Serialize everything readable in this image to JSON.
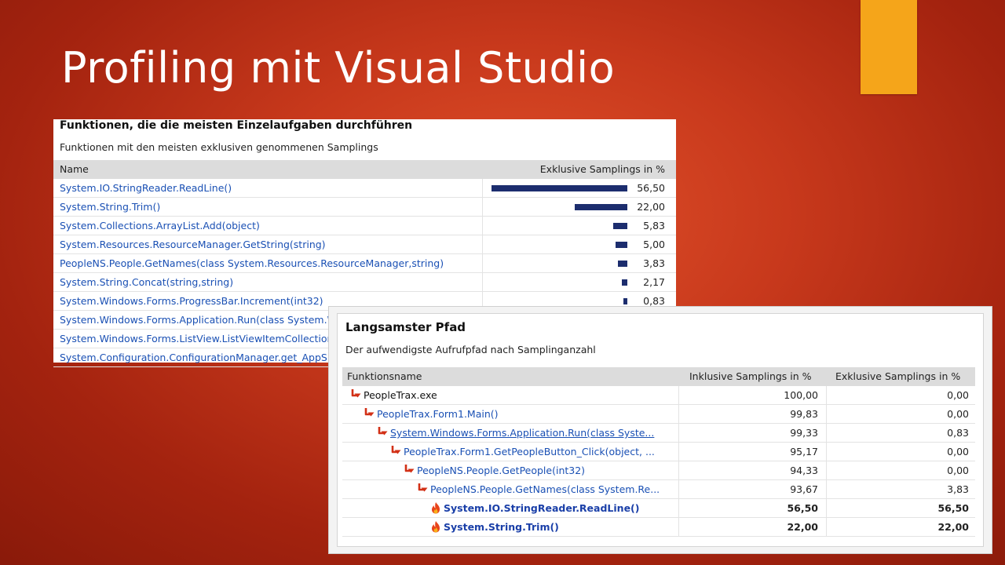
{
  "slide": {
    "title": "Profiling mit Visual Studio",
    "accent_color": "#f5a51a",
    "background_color": "#c8391c"
  },
  "panel1": {
    "title": "Funktionen, die die meisten Einzelaufgaben durchführen",
    "subtitle": "Funktionen mit den meisten exklusiven genommenen Samplings",
    "columns": {
      "name": "Name",
      "exclusive": "Exklusive Samplings in %"
    },
    "rows": [
      {
        "name": "System.IO.StringReader.ReadLine()",
        "value": "56,50",
        "pct": 56.5
      },
      {
        "name": "System.String.Trim()",
        "value": "22,00",
        "pct": 22.0
      },
      {
        "name": "System.Collections.ArrayList.Add(object)",
        "value": "5,83",
        "pct": 5.83
      },
      {
        "name": "System.Resources.ResourceManager.GetString(string)",
        "value": "5,00",
        "pct": 5.0
      },
      {
        "name": "PeopleNS.People.GetNames(class System.Resources.ResourceManager,string)",
        "value": "3,83",
        "pct": 3.83
      },
      {
        "name": "System.String.Concat(string,string)",
        "value": "2,17",
        "pct": 2.17
      },
      {
        "name": "System.Windows.Forms.ProgressBar.Increment(int32)",
        "value": "0,83",
        "pct": 0.83
      },
      {
        "name": "System.Windows.Forms.Application.Run(class System.W",
        "value": "",
        "pct": 0
      },
      {
        "name": "System.Windows.Forms.ListView.ListViewItemCollection",
        "value": "",
        "pct": 0
      },
      {
        "name": "System.Configuration.ConfigurationManager.get_AppS",
        "value": "",
        "pct": 0
      }
    ]
  },
  "panel2": {
    "title": "Langsamster Pfad",
    "subtitle": "Der aufwendigste Aufrufpfad nach Samplinganzahl",
    "columns": {
      "name": "Funktionsname",
      "inclusive": "Inklusive Samplings in %",
      "exclusive": "Exklusive Samplings in %"
    },
    "rows": [
      {
        "name": "PeopleTrax.exe",
        "inclusive": "100,00",
        "exclusive": "0,00",
        "level": 0,
        "icon": "arrow-down-icon",
        "style": "root"
      },
      {
        "name": "PeopleTrax.Form1.Main()",
        "inclusive": "99,83",
        "exclusive": "0,00",
        "level": 1,
        "icon": "arrow-down-icon",
        "style": "normal"
      },
      {
        "name": "System.Windows.Forms.Application.Run(class Syste...",
        "inclusive": "99,33",
        "exclusive": "0,83",
        "level": 2,
        "icon": "arrow-down-icon",
        "style": "link"
      },
      {
        "name": "PeopleTrax.Form1.GetPeopleButton_Click(object, ...",
        "inclusive": "95,17",
        "exclusive": "0,00",
        "level": 3,
        "icon": "arrow-down-icon",
        "style": "normal"
      },
      {
        "name": "PeopleNS.People.GetPeople(int32)",
        "inclusive": "94,33",
        "exclusive": "0,00",
        "level": 4,
        "icon": "arrow-down-icon",
        "style": "normal"
      },
      {
        "name": "PeopleNS.People.GetNames(class System.Re...",
        "inclusive": "93,67",
        "exclusive": "3,83",
        "level": 5,
        "icon": "arrow-down-icon",
        "style": "normal"
      },
      {
        "name": "System.IO.StringReader.ReadLine()",
        "inclusive": "56,50",
        "exclusive": "56,50",
        "level": 6,
        "icon": "flame-icon",
        "style": "hot"
      },
      {
        "name": "System.String.Trim()",
        "inclusive": "22,00",
        "exclusive": "22,00",
        "level": 6,
        "icon": "flame-icon",
        "style": "hot"
      }
    ]
  }
}
